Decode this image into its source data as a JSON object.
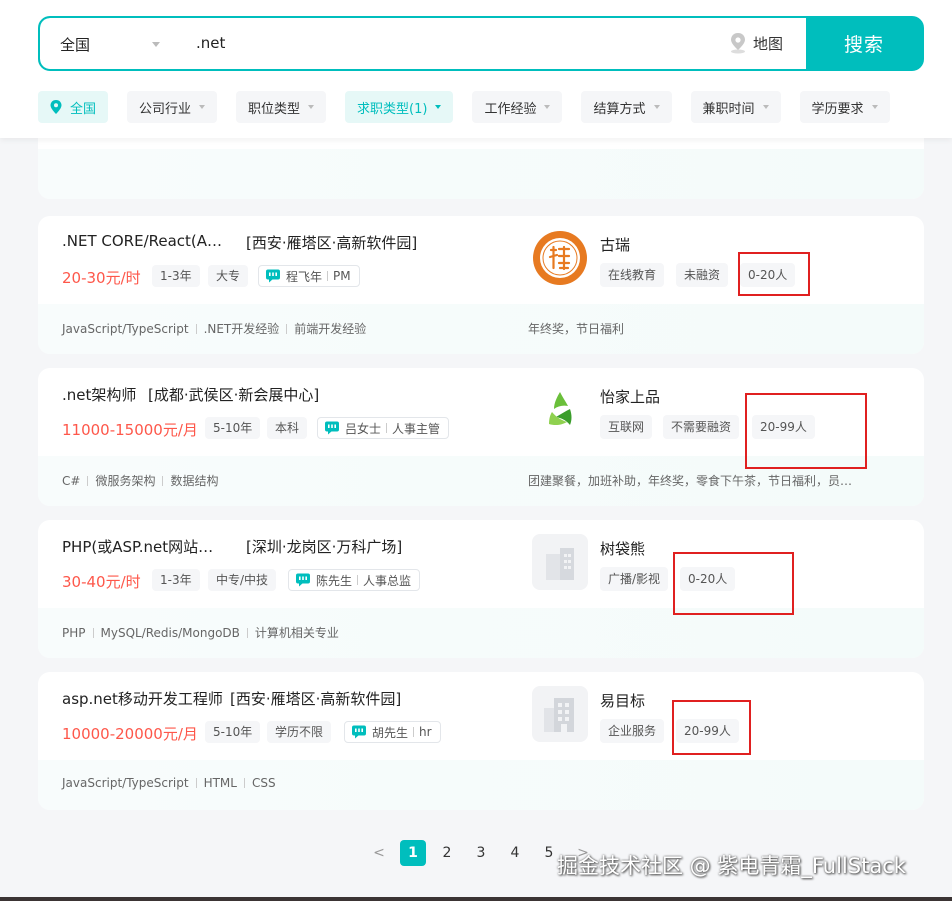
{
  "search": {
    "city": "全国",
    "query": ".net",
    "map_label": "地图",
    "button_label": "搜索"
  },
  "filters": [
    {
      "label": "全国",
      "active": true
    },
    {
      "label": "公司行业"
    },
    {
      "label": "职位类型"
    },
    {
      "label": "求职类型(1)",
      "active": true
    },
    {
      "label": "工作经验"
    },
    {
      "label": "结算方式"
    },
    {
      "label": "兼职时间"
    },
    {
      "label": "学历要求"
    }
  ],
  "jobs": [
    {
      "title": ".NET CORE/React(A…",
      "area": "[西安·雁塔区·高新软件园]",
      "salary": "20-30元/时",
      "tags": [
        "1-3年",
        "大专"
      ],
      "boss_name": "程飞年",
      "boss_title": "PM",
      "skills": [
        "JavaScript/TypeScript",
        ".NET开发经验",
        "前端开发经验"
      ],
      "welfare": "年终奖，节日福利",
      "company": "古瑞",
      "company_tags": [
        "在线教育",
        "未融资",
        "0-20人"
      ]
    },
    {
      "title": ".net架构师",
      "area": "[成都·武侯区·新会展中心]",
      "salary": "11000-15000元/月",
      "tags": [
        "5-10年",
        "本科"
      ],
      "boss_name": "吕女士",
      "boss_title": "人事主管",
      "skills": [
        "C#",
        "微服务架构",
        "数据结构"
      ],
      "welfare": "团建聚餐，加班补助，年终奖，零食下午茶，节日福利，员…",
      "company": "怡家上品",
      "company_tags": [
        "互联网",
        "不需要融资",
        "20-99人"
      ]
    },
    {
      "title": "PHP(或ASP.net网站…",
      "area": "[深圳·龙岗区·万科广场]",
      "salary": "30-40元/时",
      "tags": [
        "1-3年",
        "中专/中技"
      ],
      "boss_name": "陈先生",
      "boss_title": "人事总监",
      "skills": [
        "PHP",
        "MySQL/Redis/MongoDB",
        "计算机相关专业"
      ],
      "welfare": "",
      "company": "树袋熊",
      "company_tags": [
        "广播/影视",
        "0-20人"
      ]
    },
    {
      "title": "asp.net移动开发工程师",
      "area": "[西安·雁塔区·高新软件园]",
      "salary": "10000-20000元/月",
      "tags": [
        "5-10年",
        "学历不限"
      ],
      "boss_name": "胡先生",
      "boss_title": "hr",
      "skills": [
        "JavaScript/TypeScript",
        "HTML",
        "CSS"
      ],
      "welfare": "",
      "company": "易目标",
      "company_tags": [
        "企业服务",
        "20-99人"
      ]
    }
  ],
  "pagination": {
    "prev": "<",
    "pages": [
      "1",
      "2",
      "3",
      "4",
      "5"
    ],
    "current": "1",
    "next": ">"
  },
  "watermark": "掘金技术社区 @ 紫电青霜_FullStack",
  "colors": {
    "accent": "#00bebd",
    "salary": "#fe574a",
    "highlight": "#e02020"
  }
}
